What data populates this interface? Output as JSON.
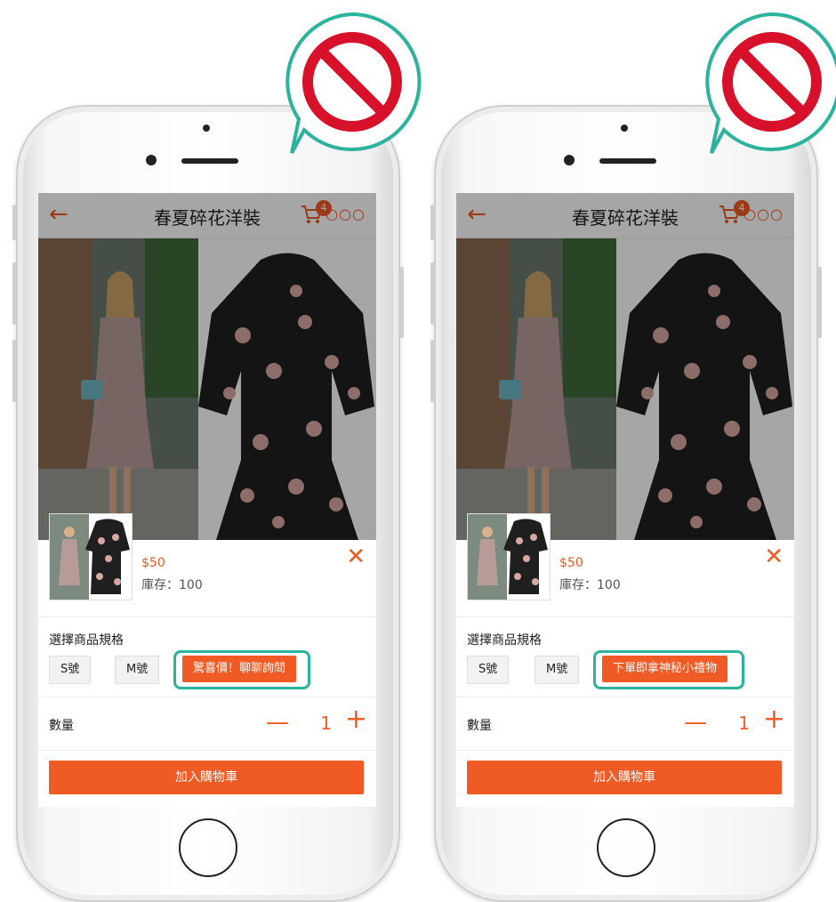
{
  "colors": {
    "accent": "#f05a24",
    "highlight": "#2bb39d",
    "prohibit": "#d8112a"
  },
  "nav": {
    "back_icon": "left-arrow-icon",
    "title": "春夏碎花洋裝",
    "cart_badge": "4",
    "more_icon": "more-dots-icon"
  },
  "product": {
    "price": "$50",
    "stock": "庫存：100"
  },
  "spec": {
    "label": "選擇商品規格"
  },
  "quantity": {
    "label": "數量",
    "minus": "—",
    "value": "1",
    "plus": "+"
  },
  "add_to_cart": "加入購物車",
  "screens": [
    {
      "options": [
        "S號",
        "M號",
        "驚喜價！聊聊詢問"
      ]
    },
    {
      "options": [
        "S號",
        "M號",
        "下單即拿神秘小禮物"
      ]
    }
  ],
  "badge_icon": "prohibited-icon"
}
